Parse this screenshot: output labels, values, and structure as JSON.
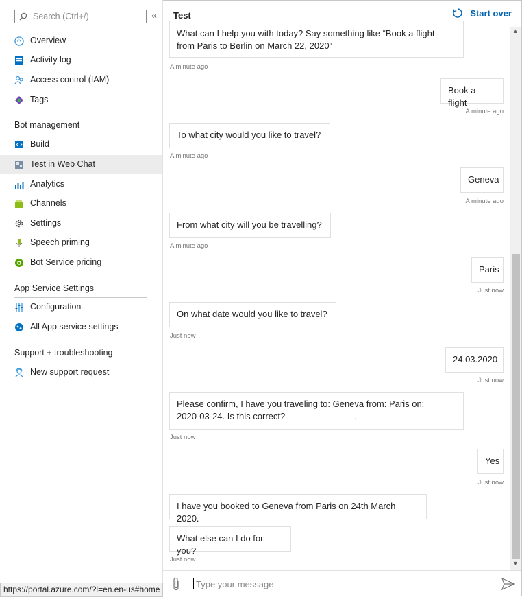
{
  "sidebar": {
    "search_placeholder": "Search (Ctrl+/)",
    "collapse_glyph": "«",
    "items_top": [
      {
        "label": "Overview",
        "icon": "overview-icon"
      },
      {
        "label": "Activity log",
        "icon": "activity-log-icon"
      },
      {
        "label": "Access control (IAM)",
        "icon": "access-control-icon"
      },
      {
        "label": "Tags",
        "icon": "tags-icon"
      }
    ],
    "section_bot": "Bot management",
    "items_bot": [
      {
        "label": "Build",
        "icon": "build-icon"
      },
      {
        "label": "Test in Web Chat",
        "icon": "web-chat-icon",
        "selected": true
      },
      {
        "label": "Analytics",
        "icon": "analytics-icon"
      },
      {
        "label": "Channels",
        "icon": "channels-icon"
      },
      {
        "label": "Settings",
        "icon": "gear-icon"
      },
      {
        "label": "Speech priming",
        "icon": "microphone-icon"
      },
      {
        "label": "Bot Service pricing",
        "icon": "pricing-icon"
      }
    ],
    "section_app": "App Service Settings",
    "items_app": [
      {
        "label": "Configuration",
        "icon": "configuration-icon"
      },
      {
        "label": "All App service settings",
        "icon": "app-service-icon"
      }
    ],
    "section_support": "Support + troubleshooting",
    "items_support": [
      {
        "label": "New support request",
        "icon": "support-icon"
      }
    ]
  },
  "chat": {
    "title": "Test",
    "start_over": "Start over",
    "messages": [
      {
        "from": "bot",
        "text": "What can I help you with today? Say something like “Book a flight\nfrom Paris to Berlin on March 22, 2020”",
        "time": "A minute ago"
      },
      {
        "from": "user",
        "text": "Book a flight",
        "time": "A minute ago"
      },
      {
        "from": "bot",
        "text": "To what city would you like to travel?",
        "time": "A minute ago"
      },
      {
        "from": "user",
        "text": "Geneva",
        "time": "A minute ago"
      },
      {
        "from": "bot",
        "text": "From what city will you be travelling?",
        "time": "A minute ago"
      },
      {
        "from": "user",
        "text": "Paris",
        "time": "Just now"
      },
      {
        "from": "bot",
        "text": "On what date would you like to travel?",
        "time": "Just now"
      },
      {
        "from": "user",
        "text": "24.03.2020",
        "time": "Just now"
      },
      {
        "from": "bot",
        "text": "Please confirm, I have you traveling to: Geneva from: Paris on:\n2020-03-24. Is this correct?                            .",
        "time": "Just now"
      },
      {
        "from": "user",
        "text": "Yes",
        "time": "Just now"
      },
      {
        "from": "bot",
        "text": "I have you booked to Geneva from Paris on 24th March 2020.",
        "time": ""
      },
      {
        "from": "bot",
        "text": "What else can I do for you?",
        "time": "Just now"
      }
    ],
    "input_placeholder": "Type your message"
  },
  "statusbar": {
    "url": "https://portal.azure.com/?l=en.en-us#home"
  },
  "colors": {
    "accent": "#0063b1",
    "selected_bg": "#ececec",
    "scroll_thumb": "#c1c1c1"
  }
}
